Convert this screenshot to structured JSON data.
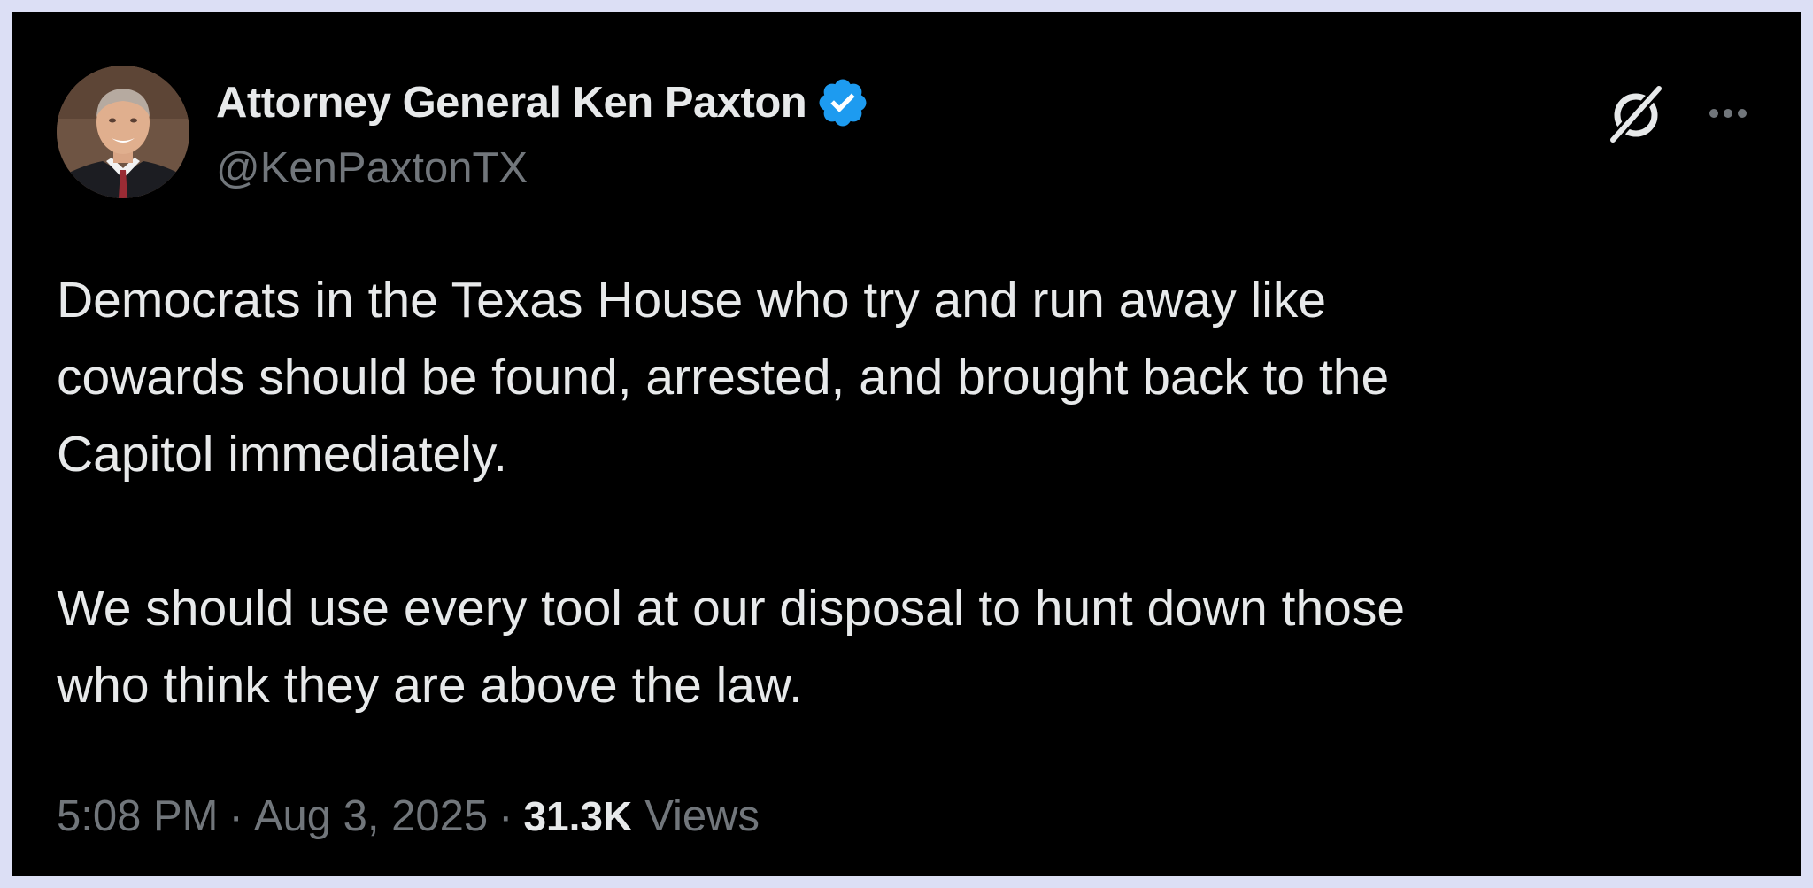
{
  "author": {
    "display_name": "Attorney General Ken Paxton",
    "handle": "@KenPaxtonTX",
    "verified_icon": "verified-badge-icon",
    "verified_color": "#1d9bf0"
  },
  "actions": {
    "grok_icon": "grok-icon",
    "more_icon": "more-options-icon"
  },
  "tweet": {
    "paragraph_1_lines": [
      "Democrats in the Texas House who try and run away like",
      "cowards should be found, arrested, and brought back to the",
      "Capitol immediately."
    ],
    "paragraph_2_lines": [
      "We should use every tool at our disposal to hunt down those",
      "who think they are above the law."
    ]
  },
  "meta": {
    "time": "5:08 PM",
    "separator": "·",
    "date": "Aug 3, 2025",
    "views_count": "31.3K",
    "views_label": "Views"
  },
  "colors": {
    "page_background": "#dcdff5",
    "card_background": "#000000",
    "primary_text": "#e7e9ea",
    "secondary_text": "#71767b"
  }
}
